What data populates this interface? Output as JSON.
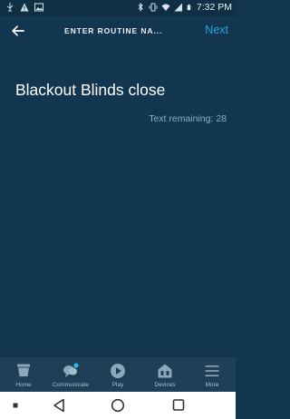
{
  "status_bar": {
    "time": "7:32 PM",
    "left_icons": [
      "usb-icon",
      "warning-icon",
      "image-icon"
    ],
    "right_icons": [
      "bluetooth-icon",
      "vibrate-icon",
      "wifi-icon",
      "signal-icon",
      "battery-icon"
    ]
  },
  "header": {
    "title": "ENTER ROUTINE NA...",
    "next_label": "Next",
    "back_icon": "arrow-left-icon"
  },
  "content": {
    "routine_name": "Blackout Blinds close",
    "text_remaining": "Text remaining: 28"
  },
  "bottom_nav": {
    "items": [
      {
        "label": "Home",
        "icon": "home-icon"
      },
      {
        "label": "Communicate",
        "icon": "chat-bubbles-icon",
        "has_badge": true
      },
      {
        "label": "Play",
        "icon": "play-icon"
      },
      {
        "label": "Devices",
        "icon": "devices-house-icon"
      },
      {
        "label": "More",
        "icon": "menu-lines-icon"
      }
    ]
  },
  "system_nav": {
    "buttons": [
      "recent-dot-icon",
      "back-triangle-icon",
      "home-circle-icon",
      "overview-square-icon"
    ]
  },
  "colors": {
    "background": "#12364f",
    "accent": "#27a7df",
    "nav_background": "#1d3f57"
  }
}
